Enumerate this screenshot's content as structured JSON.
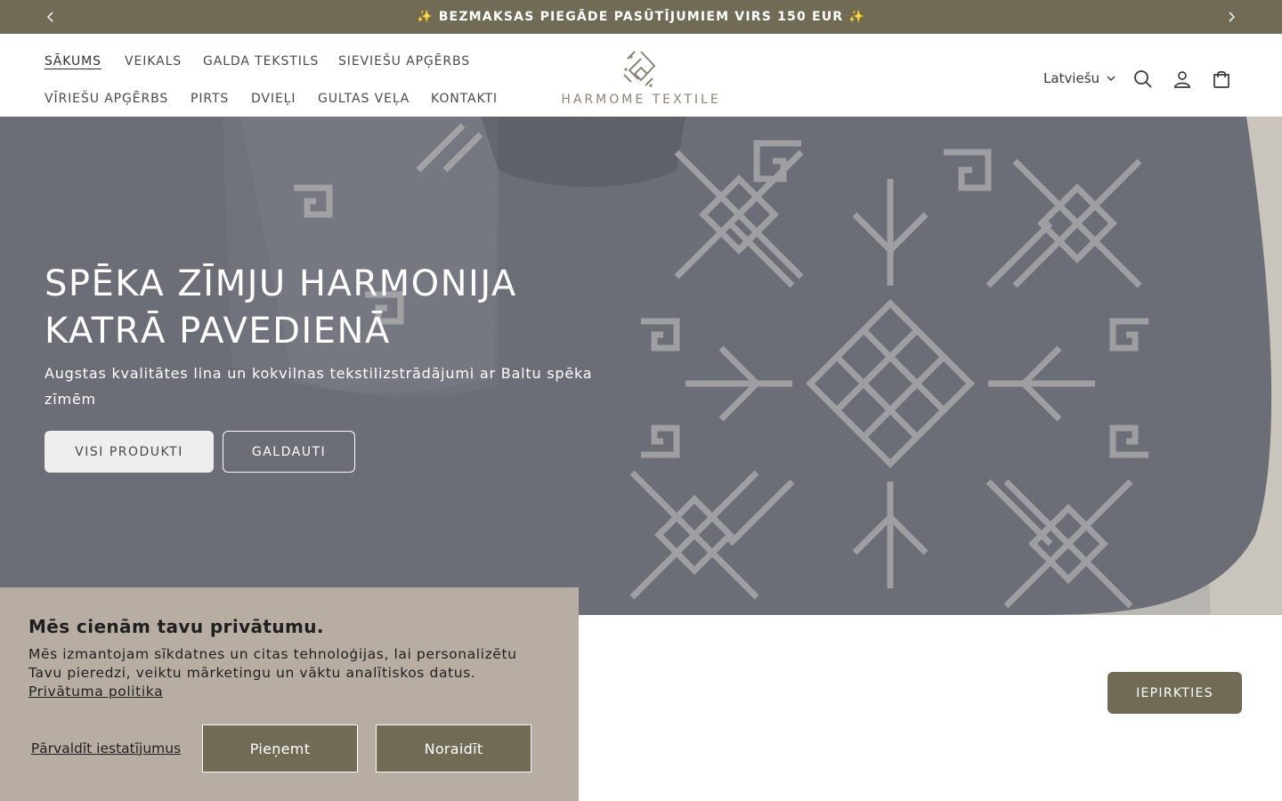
{
  "announcement": {
    "text": "✨ BEZMAKSAS PIEGĀDE PASŪTĪJUMIEM VIRS 150 EUR ✨",
    "prev_icon": "chevron-left-icon",
    "next_icon": "chevron-right-icon"
  },
  "nav": {
    "items": [
      {
        "label": "SĀKUMS",
        "active": true
      },
      {
        "label": "VEIKALS"
      },
      {
        "label": "GALDA TEKSTILS"
      },
      {
        "label": "SIEVIEŠU APĢĒRBS"
      },
      {
        "label": "VĪRIEŠU APĢĒRBS"
      },
      {
        "label": "PIRTS"
      },
      {
        "label": "DVIEĻI"
      },
      {
        "label": "GULTAS VEĻA"
      },
      {
        "label": "KONTAKTI"
      }
    ]
  },
  "logo": {
    "text": "HARMOME TEXTILE"
  },
  "header_tools": {
    "language": "Latviešu",
    "icons": [
      "search-icon",
      "account-icon",
      "cart-icon"
    ]
  },
  "hero": {
    "title_line1": "SPĒKA ZĪMJU HARMONIJA",
    "title_line2": "KATRĀ PAVEDIENĀ",
    "subtitle": "Augstas kvalitātes lina un kokvilnas tekstilizstrādājumi ar Baltu spēka zīmēm",
    "primary_button": "VISI PRODUKTI",
    "secondary_button": "GALDAUTI"
  },
  "shop_button": "IEPIRKTIES",
  "cookie": {
    "title": "Mēs cienām tavu privātumu.",
    "text": "Mēs izmantojam sīkdatnes un citas tehnoloģijas, lai personalizētu Tavu pieredzi, veiktu mārketingu un vāktu analītiskos datus.",
    "policy_link": "Privātuma politika",
    "manage": "Pārvaldīt iestatījumus",
    "accept": "Pieņemt",
    "reject": "Noraidīt"
  },
  "colors": {
    "accent": "#716b56",
    "cookie_bg": "#b8ada3",
    "hero_fabric": "#6a6d75"
  }
}
